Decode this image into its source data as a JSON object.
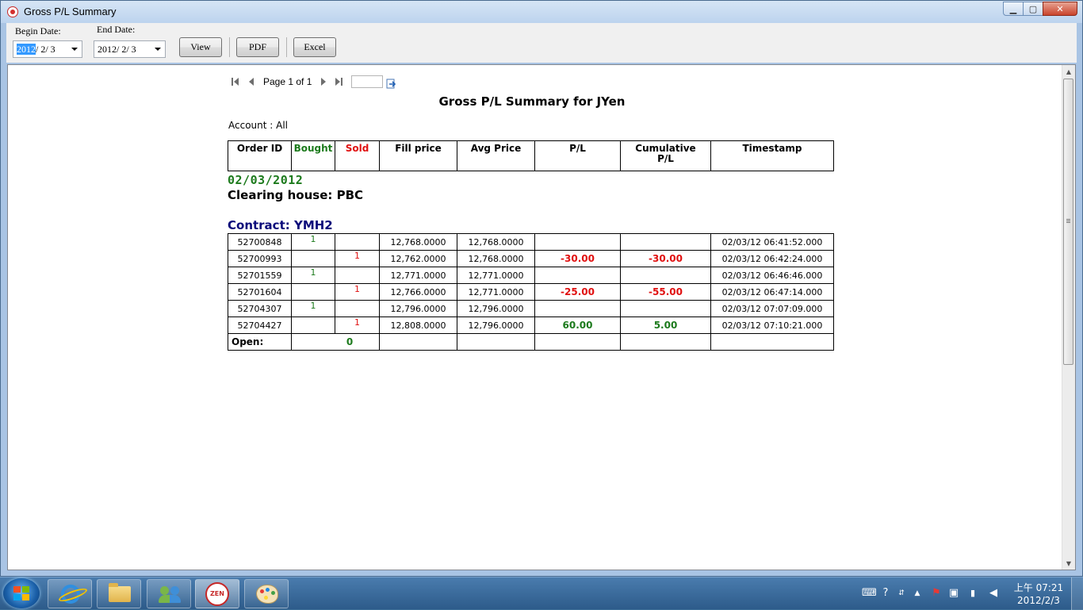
{
  "window": {
    "title": "Gross P/L Summary",
    "controls": {
      "minimize": "▁",
      "maximize": "▢",
      "close": "✕"
    }
  },
  "toolbar": {
    "begin_label": "Begin Date:",
    "begin_year": "2012",
    "begin_rest": "/  2/  3",
    "end_label": "End Date:",
    "end_value": "2012/  2/  3",
    "view_button": "View",
    "pdf_button": "PDF",
    "excel_button": "Excel"
  },
  "pager": {
    "page_text": "Page 1 of 1",
    "page_input": ""
  },
  "report": {
    "title": "Gross P/L Summary for JYen",
    "account": "Account : All",
    "headers": {
      "order_id": "Order ID",
      "bought": "Bought",
      "sold": "Sold",
      "fill_price": "Fill price",
      "avg_price": "Avg Price",
      "pl": "P/L",
      "cumulative_line1": "Cumulative",
      "cumulative_line2": "P/L",
      "timestamp": "Timestamp"
    },
    "date_group": "02/03/2012",
    "clearing_house": "Clearing house: PBC",
    "contract": "Contract: YMH2",
    "rows": [
      {
        "order_id": "52700848",
        "bought": "1",
        "sold": "",
        "fill_price": "12,768.0000",
        "avg_price": "12,768.0000",
        "pl": "",
        "cum_pl": "",
        "timestamp": "02/03/12 06:41:52.000"
      },
      {
        "order_id": "52700993",
        "bought": "",
        "sold": "1",
        "fill_price": "12,762.0000",
        "avg_price": "12,768.0000",
        "pl": "-30.00",
        "cum_pl": "-30.00",
        "timestamp": "02/03/12 06:42:24.000"
      },
      {
        "order_id": "52701559",
        "bought": "1",
        "sold": "",
        "fill_price": "12,771.0000",
        "avg_price": "12,771.0000",
        "pl": "",
        "cum_pl": "",
        "timestamp": "02/03/12 06:46:46.000"
      },
      {
        "order_id": "52701604",
        "bought": "",
        "sold": "1",
        "fill_price": "12,766.0000",
        "avg_price": "12,771.0000",
        "pl": "-25.00",
        "cum_pl": "-55.00",
        "timestamp": "02/03/12 06:47:14.000"
      },
      {
        "order_id": "52704307",
        "bought": "1",
        "sold": "",
        "fill_price": "12,796.0000",
        "avg_price": "12,796.0000",
        "pl": "",
        "cum_pl": "",
        "timestamp": "02/03/12 07:07:09.000"
      },
      {
        "order_id": "52704427",
        "bought": "",
        "sold": "1",
        "fill_price": "12,808.0000",
        "avg_price": "12,796.0000",
        "pl": "60.00",
        "cum_pl": "5.00",
        "timestamp": "02/03/12 07:10:21.000"
      }
    ],
    "open_label": "Open:",
    "open_value": "0"
  },
  "taskbar": {
    "items": [
      "internet-explorer",
      "file-explorer",
      "messenger",
      "global-zen",
      "paint"
    ],
    "clock_time": "上午 07:21",
    "clock_date": "2012/2/3"
  },
  "colors": {
    "positive": "#1c7a1c",
    "negative": "#e01010",
    "contract": "#0a0a7a"
  }
}
